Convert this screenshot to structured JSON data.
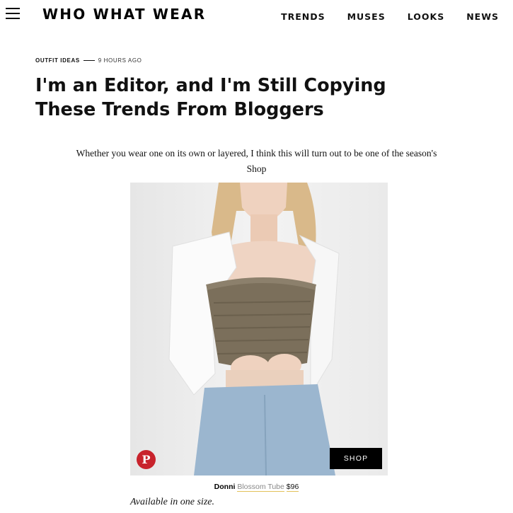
{
  "header": {
    "logo": "WHO WHAT WEAR",
    "nav": [
      "TRENDS",
      "MUSES",
      "LOOKS",
      "NEWS"
    ]
  },
  "article": {
    "category": "OUTFIT IDEAS",
    "time": "9 HOURS AGO",
    "title": "I'm an Editor, and I'm Still Copying These Trends From Bloggers",
    "intro_line1": "Whether you wear one on its own or layered, I think this will turn out to be one of the season's",
    "intro_line2": "Shop"
  },
  "product": {
    "pin_glyph": "P",
    "shop_label": "SHOP",
    "brand": "Donni",
    "name": "Blossom Tube",
    "price": "$96",
    "availability": "Available in one size."
  },
  "colors": {
    "pinterest": "#c8232c",
    "shop_button": "#000000",
    "link_underline": "#e2c15a"
  }
}
